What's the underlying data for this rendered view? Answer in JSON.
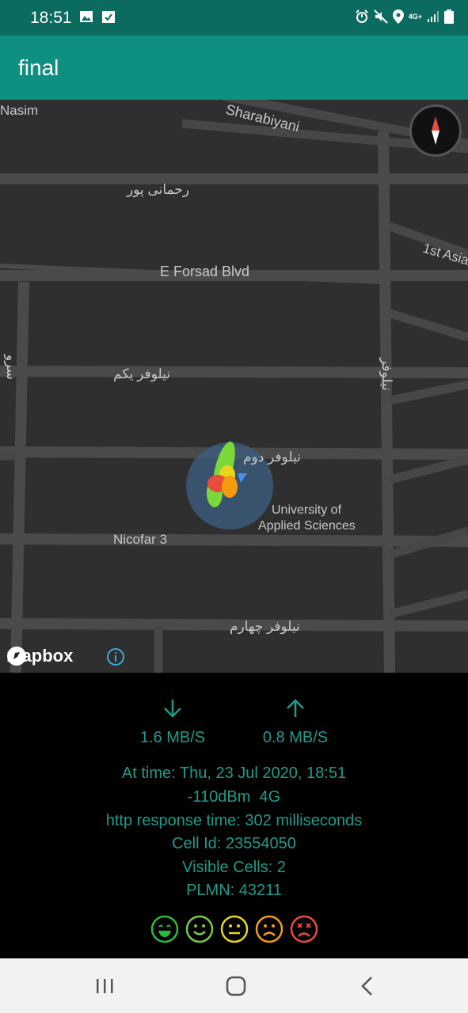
{
  "status_bar": {
    "time": "18:51",
    "left_icons": [
      "image-icon",
      "check-icon"
    ],
    "right_icons": [
      "alarm-icon",
      "mute-icon",
      "location-icon",
      "4g-icon",
      "signal-icon",
      "battery-icon"
    ],
    "network_label": "4G+"
  },
  "app_bar": {
    "title": "final"
  },
  "map": {
    "labels": {
      "nasim": "Nasim",
      "sharabiyani": "Sharabiyani",
      "rahmani_pour": "رحمانی پور",
      "forsad_blvd": "E Forsad Blvd",
      "first_asia": "1st Asia",
      "sarv": "سرو",
      "niloufar_1": "نیلوفر یکم",
      "niloufar_vertical": "نیلوفر",
      "niloufar_2": "نیلوفر دوم",
      "university_line1": "University of",
      "university_line2": "Applied Sciences",
      "nicofar3": "Nicofar 3",
      "niloufar_4": "نیلوفر چهارم"
    },
    "attribution": "mapbox"
  },
  "panel": {
    "download_speed": "1.6 MB/S",
    "upload_speed": "0.8 MB/S",
    "time_line": "At time: Thu, 23 Jul 2020, 18:51",
    "signal_line": "-110dBm  4G",
    "http_line": "http response time: 302 milliseconds",
    "cell_id_line": "Cell Id: 23554050",
    "visible_cells_line": "Visible Cells: 2",
    "plmn_line": "PLMN: 43211",
    "accent_color": "#1f9b89",
    "rating_colors": [
      "#2db83d",
      "#7ac943",
      "#e8d41c",
      "#f39c12",
      "#e74c3c"
    ]
  }
}
